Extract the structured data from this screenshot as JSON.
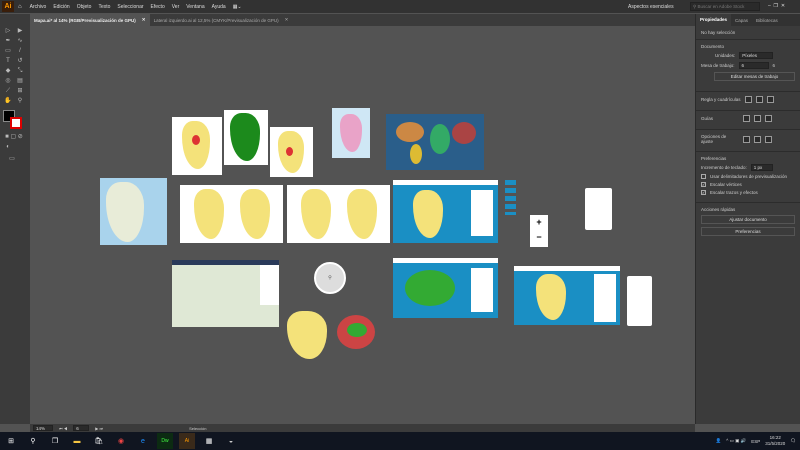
{
  "app": {
    "logo": "Ai",
    "menus": [
      "Archivo",
      "Edición",
      "Objeto",
      "Texto",
      "Seleccionar",
      "Efecto",
      "Ver",
      "Ventana",
      "Ayuda"
    ],
    "workspace": "Aspectos esenciales",
    "search_placeholder": "Buscar en Adobe Stock"
  },
  "tabs": [
    {
      "label": "Mapa.ai* al 14% (RGB/Previsualización de GPU)",
      "active": true
    },
    {
      "label": "Lateral izquierdo.ai al 12,5% (CMYK/Previsualización de GPU)",
      "active": false
    }
  ],
  "panel": {
    "tabs": [
      "Propiedades",
      "Capas",
      "Bibliotecas"
    ],
    "no_selection": "No hay selección",
    "document_title": "Documento",
    "units_label": "Unidades:",
    "units_value": "Píxeles",
    "artboard_label": "Mesa de trabajo:",
    "artboard_value": "6",
    "artboard_count": "6",
    "edit_artboards": "Editar mesas de trabajo",
    "rulers_label": "Regla y cuadrículas",
    "guides_label": "Guías",
    "snap_label": "Opciones de ajuste",
    "prefs_title": "Preferencias",
    "keyboard_inc_label": "Incremento de teclado:",
    "keyboard_inc_value": "1 px",
    "preview_bounds": "Usar delimitadores de previsualización",
    "scale_corners": "Escalar vértices",
    "scale_strokes": "Escalar trazos y efectos",
    "preview_checked": false,
    "corners_checked": true,
    "strokes_checked": true,
    "quick_actions": "Acciones rápidas",
    "fit_document": "Ajustar documento",
    "preferences_btn": "Preferencias"
  },
  "status": {
    "zoom": "14%",
    "artboard_nav": "6",
    "tool": "Selección"
  },
  "taskbar": {
    "lang": "ESP",
    "time": "16:22",
    "date": "31/5/2020"
  },
  "colors": {
    "accent": "#ff9a00",
    "ocean": "#1a8fc4",
    "land": "#f4e27a"
  }
}
